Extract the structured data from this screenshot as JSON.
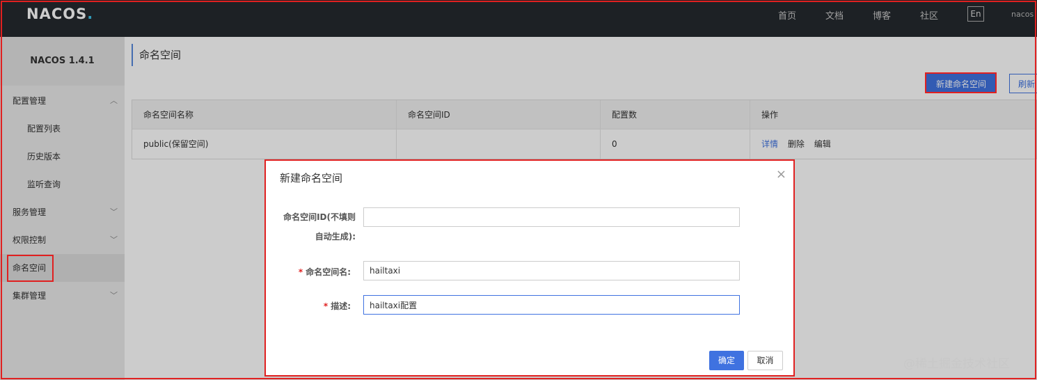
{
  "topbar": {
    "logo_text": "NACOS",
    "logo_dot": ".",
    "nav": [
      "首页",
      "文档",
      "博客",
      "社区"
    ],
    "lang": "En",
    "user": "nacos"
  },
  "sidebar": {
    "brand": "NACOS 1.4.1",
    "items": [
      {
        "label": "配置管理",
        "chevron": "^"
      },
      {
        "label": "配置列表"
      },
      {
        "label": "历史版本"
      },
      {
        "label": "监听查询"
      },
      {
        "label": "服务管理",
        "chevron": "v"
      },
      {
        "label": "权限控制",
        "chevron": "v"
      },
      {
        "label": "命名空间"
      },
      {
        "label": "集群管理",
        "chevron": "v"
      }
    ]
  },
  "main": {
    "title": "命名空间",
    "new_button": "新建命名空间",
    "refresh_button": "刷新",
    "table": {
      "headers": [
        "命名空间名称",
        "命名空间ID",
        "配置数",
        "操作"
      ],
      "rows": [
        {
          "name": "public(保留空间)",
          "id": "",
          "count": "0",
          "ops": [
            "详情",
            "删除",
            "编辑"
          ]
        }
      ]
    }
  },
  "dialog": {
    "title": "新建命名空间",
    "close": "×",
    "fields": [
      {
        "label_line1": "命名空间ID(不填则",
        "label_line2": "自动生成):",
        "value": "",
        "required": false
      },
      {
        "label": "命名空间名:",
        "value": "hailtaxi",
        "required": true
      },
      {
        "label": "描述:",
        "value": "hailtaxi配置",
        "required": true
      }
    ],
    "required_mark": "*",
    "ok": "确定",
    "cancel": "取消"
  },
  "watermark": "@稀土掘金技术社区",
  "colors": {
    "accent": "#3f72e0",
    "annotation": "#e02020",
    "topbar": "#252a2f"
  }
}
